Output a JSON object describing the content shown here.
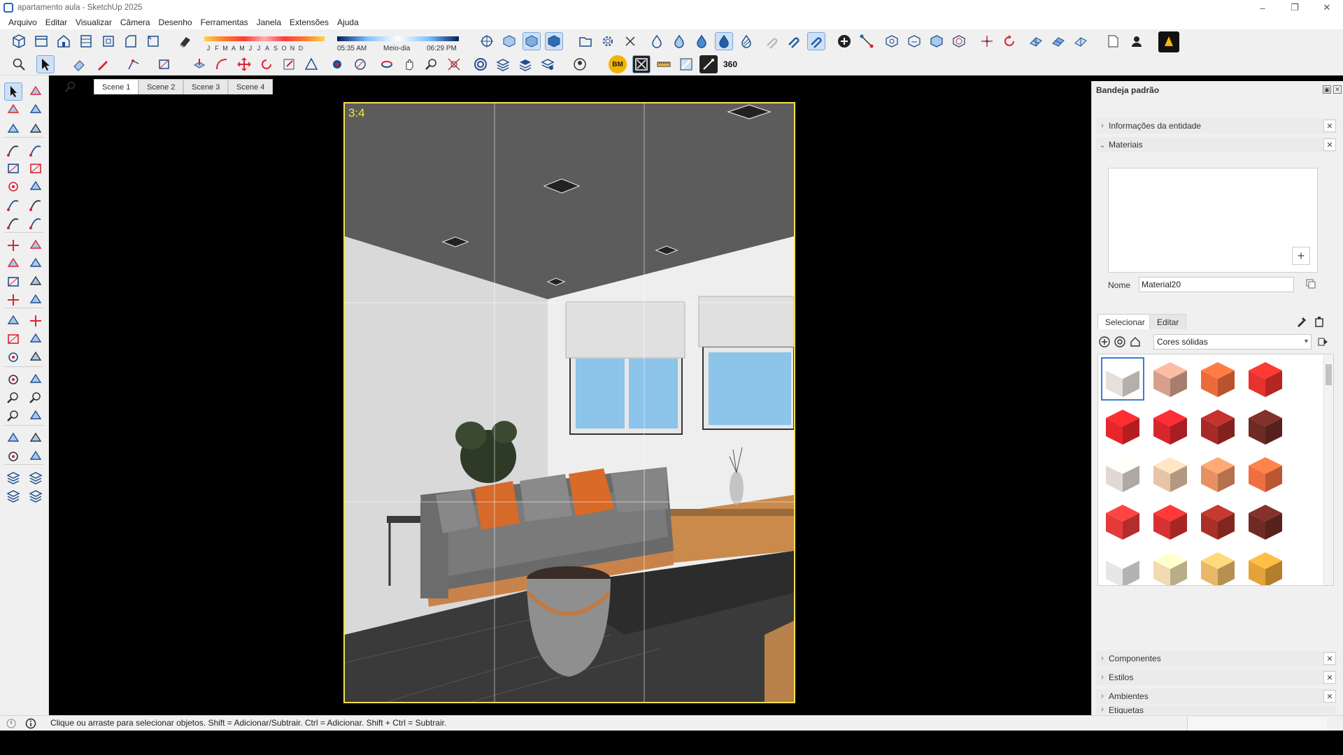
{
  "window": {
    "title": "apartamento aula - SketchUp 2025"
  },
  "menu": [
    "Arquivo",
    "Editar",
    "Visualizar",
    "Câmera",
    "Desenho",
    "Ferramentas",
    "Janela",
    "Extensões",
    "Ajuda"
  ],
  "shadow": {
    "months": [
      "J",
      "F",
      "M",
      "A",
      "M",
      "J",
      "J",
      "A",
      "S",
      "O",
      "N",
      "D"
    ],
    "time_start": "05:35 AM",
    "time_mid": "Meio-dia",
    "time_end": "06:29 PM"
  },
  "toolbar2_label_360": "360",
  "toolbar2_label_bm": "BM",
  "scenes": [
    {
      "label": "Scene 1",
      "active": true
    },
    {
      "label": "Scene 2",
      "active": false
    },
    {
      "label": "Scene 3",
      "active": false
    },
    {
      "label": "Scene 4",
      "active": false
    }
  ],
  "viewport": {
    "aspect": "3:4"
  },
  "tray": {
    "title": "Bandeja padrão",
    "panels": {
      "entity_info": "Informações da entidade",
      "materials": "Materiais",
      "components": "Componentes",
      "styles": "Estilos",
      "environments": "Ambientes",
      "tags": "Etiquetas"
    },
    "materials": {
      "name_label": "Nome",
      "name_value": "Material20",
      "tab_select": "Selecionar",
      "tab_edit": "Editar",
      "library": "Cores sólidas",
      "swatch_colors": [
        [
          "#e6e0dc",
          "#d6a08c",
          "#ec6a3a",
          "#e8302c"
        ],
        [
          "#e8262a",
          "#d8262c",
          "#a82a28",
          "#6e2a24"
        ],
        [
          "#e0d8d2",
          "#e6c4a6",
          "#e89062",
          "#ee7040"
        ],
        [
          "#e63a3a",
          "#d83030",
          "#a83028",
          "#702a24"
        ],
        [
          "#e8e6e4",
          "#f0dcb0",
          "#e8b868",
          "#e6a23a"
        ],
        [
          "#ea8a36",
          "#e87a42",
          "#b45a34",
          "#6e3a2a"
        ]
      ]
    }
  },
  "status": {
    "text": "Clique ou arraste para selecionar objetos. Shift = Adicionar/Subtrair. Ctrl = Adicionar. Shift + Ctrl = Subtrair."
  }
}
